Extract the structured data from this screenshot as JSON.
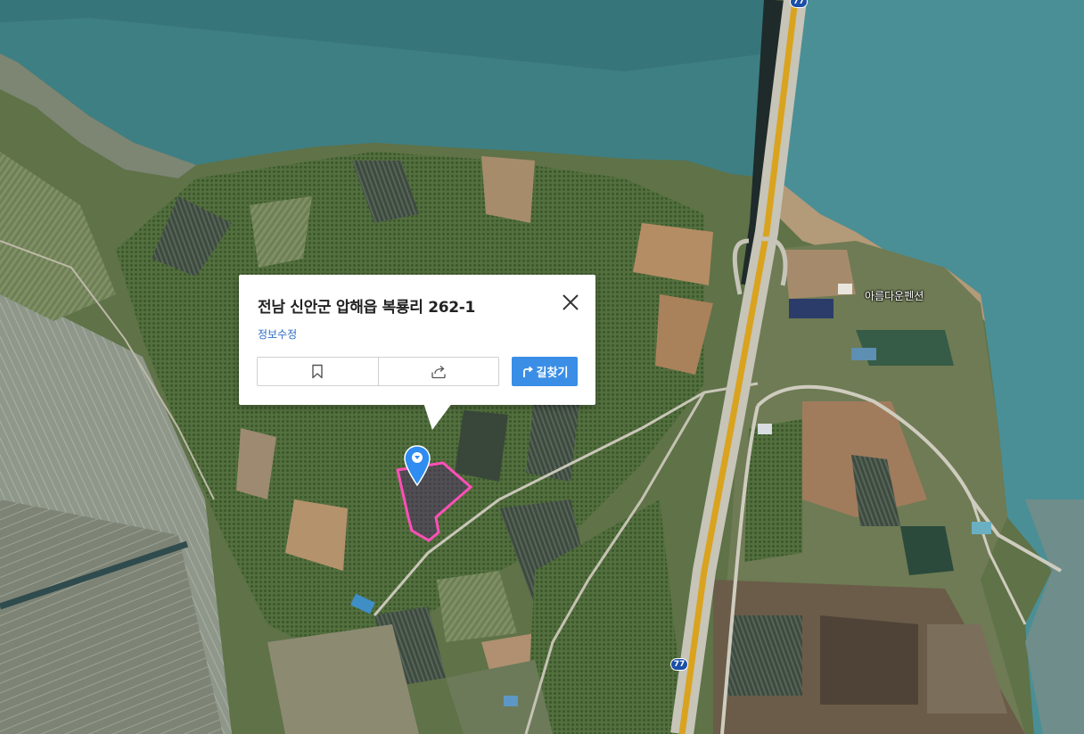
{
  "map": {
    "type": "satellite",
    "place_labels": [
      {
        "text": "아름다운펜션"
      }
    ],
    "highway_shields": [
      {
        "number": "77"
      },
      {
        "number": "77"
      }
    ],
    "colors": {
      "sea": "#3e7f83",
      "parcel_outline": "#ff4fb8",
      "highway": "#d9a31f",
      "marker": "#2f8cf0"
    }
  },
  "popup": {
    "address": "전남 신안군 압해읍 복룡리 262-1",
    "edit_link": "정보수정",
    "bookmark_icon": "bookmark-icon",
    "share_icon": "share-icon",
    "route_button": "길찾기",
    "close_icon": "close-icon"
  }
}
